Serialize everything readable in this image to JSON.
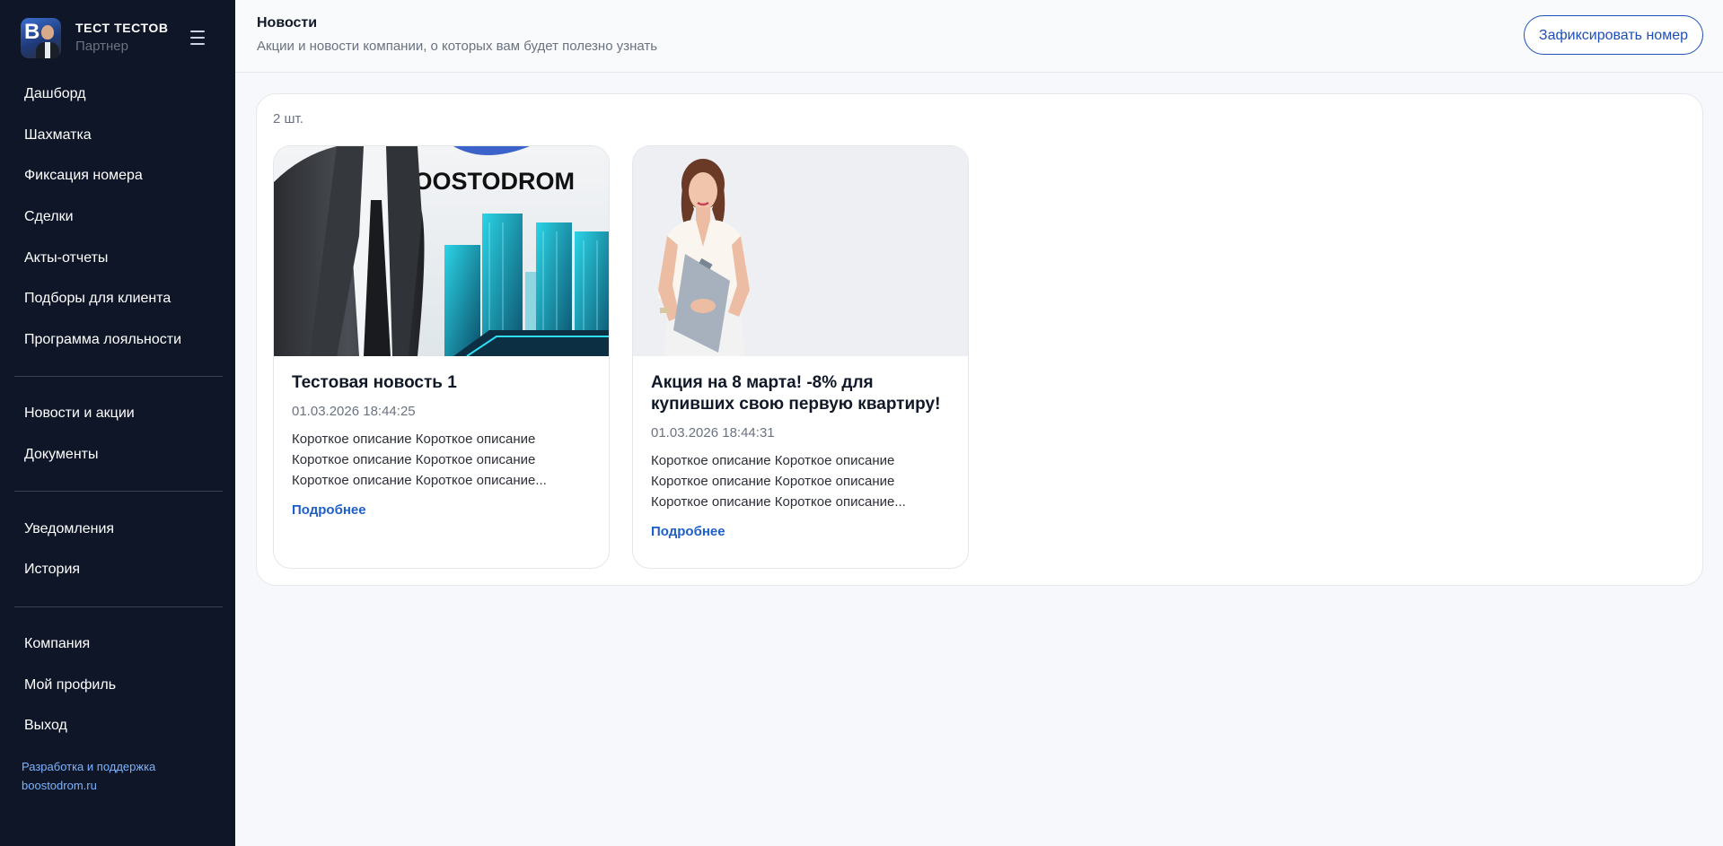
{
  "sidebar": {
    "profile": {
      "name": "ТЕСТ ТЕСТОВ",
      "role": "Партнер",
      "avatar_letter": "B"
    },
    "groups": [
      [
        "Дашборд",
        "Шахматка",
        "Фиксация номера",
        "Сделки",
        "Акты-отчеты",
        "Подборы для клиента",
        "Программа лояльности"
      ],
      [
        "Новости и акции",
        "Документы"
      ],
      [
        "Уведомления",
        "История"
      ],
      [
        "Компания",
        "Мой профиль",
        "Выход"
      ]
    ],
    "credit_line1": "Разработка и поддержка",
    "credit_line2": "boostodrom.ru"
  },
  "header": {
    "title": "Новости",
    "subtitle": "Акции и новости компании, о которых вам будет полезно узнать",
    "action_label": "Зафиксировать номер"
  },
  "main": {
    "count_label": "2 шт.",
    "cards": [
      {
        "title": "Тестовая новость 1",
        "date": "01.03.2026 18:44:25",
        "description": "Короткое описание Короткое описание Короткое описание Короткое описание Короткое описание Короткое описание...",
        "link_label": "Подробнее",
        "image_text": "BOOSTODROM"
      },
      {
        "title": "Акция на 8 марта! -8% для купивших свою первую квартиру!",
        "date": "01.03.2026 18:44:31",
        "description": "Короткое описание Короткое описание Короткое описание Короткое описание Короткое описание Короткое описание...",
        "link_label": "Подробнее"
      }
    ]
  },
  "colors": {
    "sidebar_bg": "#0e1628",
    "accent": "#1e4fb8",
    "link": "#1e5fc8",
    "credit": "#7ab3ff"
  }
}
